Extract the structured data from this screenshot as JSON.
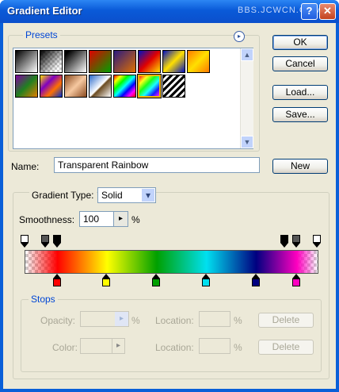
{
  "window": {
    "title": "Gradient Editor",
    "watermark": "BBS.JCWCN.COM",
    "help_glyph": "?",
    "close_glyph": "✕"
  },
  "presets": {
    "label": "Presets",
    "menu_glyph": "▸",
    "scroll_up": "▲",
    "scroll_down": "▼",
    "swatches": [
      {
        "name": "foreground-to-background",
        "css": "linear-gradient(135deg,#000,#fff)"
      },
      {
        "name": "foreground-to-transparent",
        "css": "checker-black"
      },
      {
        "name": "black-white",
        "css": "linear-gradient(135deg,#000 10%,#fff)"
      },
      {
        "name": "red-green",
        "css": "linear-gradient(135deg,#e00000,#00a000)"
      },
      {
        "name": "violet-orange",
        "css": "linear-gradient(135deg,#2a1a80,#e07000)"
      },
      {
        "name": "blue-red-yellow",
        "css": "linear-gradient(135deg,#0010c0,#e00000 50%,#ffe000)"
      },
      {
        "name": "blue-yellow-blue",
        "css": "linear-gradient(135deg,#0010c0,#ffe000 50%,#0010c0)"
      },
      {
        "name": "orange-yellow-orange",
        "css": "linear-gradient(135deg,#ff7a00,#ffe000 50%,#ff7a00)"
      },
      {
        "name": "violet-green-orange",
        "css": "linear-gradient(135deg,#8000a0,#208020 50%,#e08000)"
      },
      {
        "name": "yellow-violet-orange-blue",
        "css": "linear-gradient(135deg,#ffe000,#8000c0 35%,#ff7000 65%,#0030d0)"
      },
      {
        "name": "copper",
        "css": "linear-gradient(135deg,#8a4a20,#f6c8a0 50%,#8a4a20)"
      },
      {
        "name": "chrome",
        "css": "linear-gradient(135deg,#2a6acb,#fff 50%,#6a4a20 55%,#fff)"
      },
      {
        "name": "spectrum",
        "css": "linear-gradient(135deg,#ff0000,#ffff00,#00ff00,#00ffff,#0000ff,#ff00ff,#ff0000)"
      },
      {
        "name": "transparent-rainbow",
        "css": "checker-rainbow"
      },
      {
        "name": "transparent-stripes",
        "css": "repeating-linear-gradient(135deg,#000 0 3px,#fff 3px 6px)"
      }
    ]
  },
  "buttons": {
    "ok": "OK",
    "cancel": "Cancel",
    "load": "Load...",
    "save": "Save...",
    "new": "New"
  },
  "name": {
    "label": "Name:",
    "value": "Transparent Rainbow"
  },
  "gradient": {
    "type_label": "Gradient Type:",
    "type_value": "Solid",
    "smoothness_label": "Smoothness:",
    "smoothness_value": "100",
    "smoothness_unit": "%",
    "dropdown_glyph": "▾",
    "step_glyph": "▸"
  },
  "opacity_stops": [
    {
      "pos": 0.0,
      "color": "#ffffff"
    },
    {
      "pos": 0.07,
      "color": "#555555"
    },
    {
      "pos": 0.11,
      "color": "#000000"
    },
    {
      "pos": 0.89,
      "color": "#000000"
    },
    {
      "pos": 0.93,
      "color": "#555555"
    },
    {
      "pos": 1.0,
      "color": "#ffffff"
    }
  ],
  "color_stops": [
    {
      "pos": 0.11,
      "color": "#ff0000"
    },
    {
      "pos": 0.28,
      "color": "#ffff00"
    },
    {
      "pos": 0.45,
      "color": "#00a000"
    },
    {
      "pos": 0.62,
      "color": "#00e0f0"
    },
    {
      "pos": 0.79,
      "color": "#000080"
    },
    {
      "pos": 0.93,
      "color": "#ff00c0"
    }
  ],
  "stops": {
    "label": "Stops",
    "opacity_label": "Opacity:",
    "opacity_unit": "%",
    "color_label": "Color:",
    "location_label": "Location:",
    "location_unit": "%",
    "delete": "Delete",
    "arrow_glyph": "▸"
  }
}
